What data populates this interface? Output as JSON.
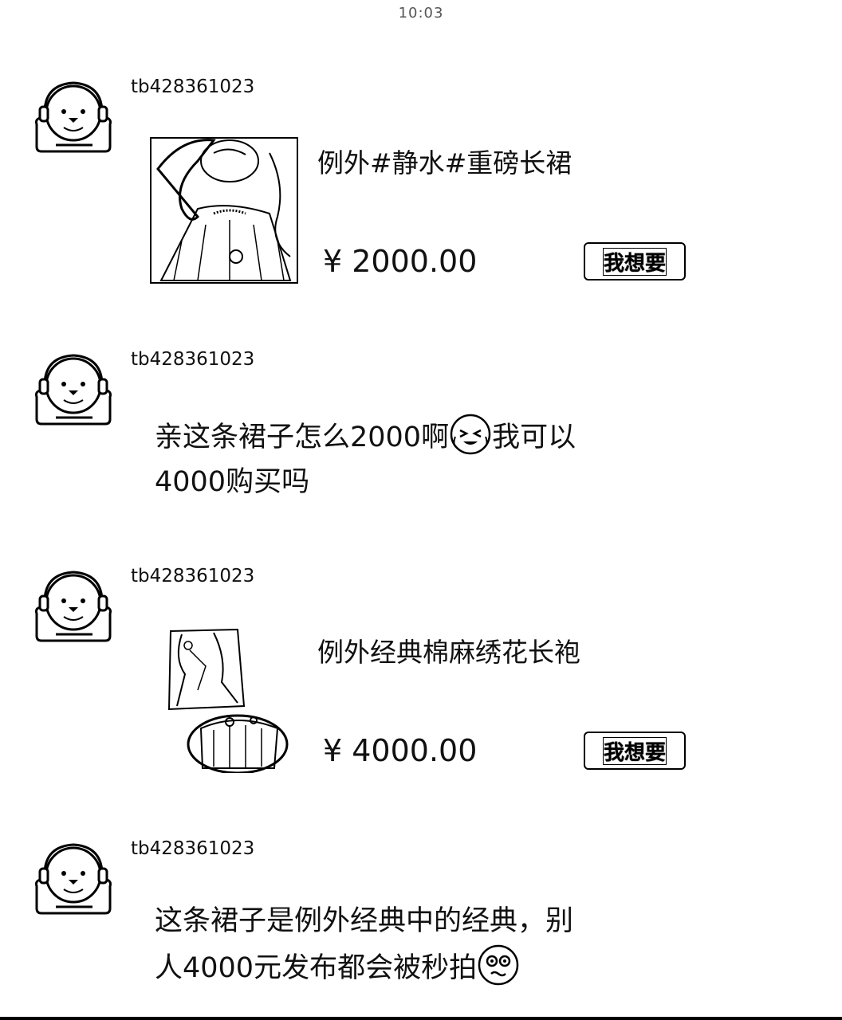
{
  "status_bar": {
    "time": "10:03"
  },
  "messages": [
    {
      "username": "tb428361023",
      "type": "product",
      "product": {
        "title": "例外#静水#重磅长裙",
        "price": "¥ 2000.00",
        "button_label": "我想要",
        "image_icon": "dress-photo"
      }
    },
    {
      "username": "tb428361023",
      "type": "text",
      "line1": "亲这条裙子怎么2000啊",
      "line1_after": "我可以",
      "line2": "4000购买吗",
      "emoji": "cry-laugh-emoji"
    },
    {
      "username": "tb428361023",
      "type": "product",
      "product": {
        "title": "例外经典棉麻绣花长袍",
        "price": "¥ 4000.00",
        "button_label": "我想要",
        "image_icon": "robe-photo"
      }
    },
    {
      "username": "tb428361023",
      "type": "text",
      "line1": "这条裙子是例外经典中的经典，别",
      "line2": "人4000元发布都会被秒拍",
      "emoji": "surprised-emoji"
    }
  ],
  "avatar_icon": "seal-headphones-avatar"
}
